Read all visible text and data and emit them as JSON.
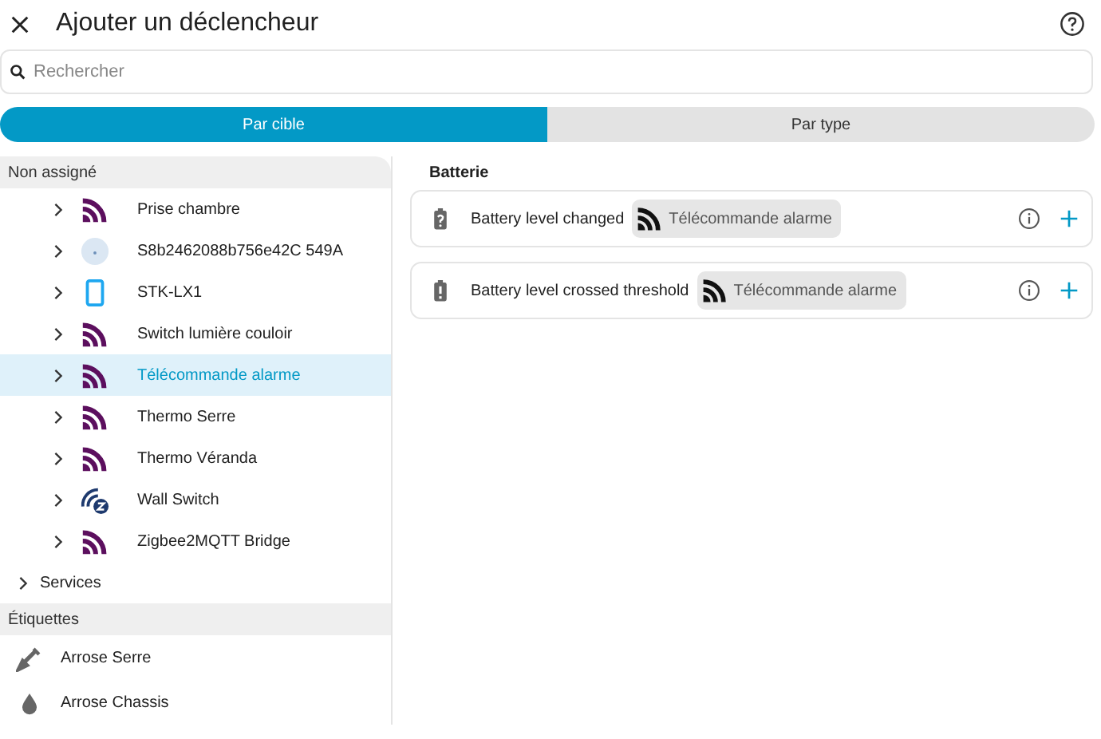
{
  "dialog": {
    "title": "Ajouter un déclencheur"
  },
  "search": {
    "placeholder": "Rechercher"
  },
  "tabs": [
    {
      "label": "Par cible",
      "selected": true
    },
    {
      "label": "Par type",
      "selected": false
    }
  ],
  "sidebar": {
    "sections": [
      {
        "title": "Non assigné",
        "items": [
          {
            "label": "Prise chambre",
            "kind": "signal",
            "selected": false
          },
          {
            "label": "S8b2462088b756e42C 549A",
            "kind": "circle",
            "selected": false
          },
          {
            "label": "STK-LX1",
            "kind": "phone",
            "selected": false
          },
          {
            "label": "Switch lumière couloir",
            "kind": "signal",
            "selected": false
          },
          {
            "label": "Télécommande alarme",
            "kind": "signal",
            "selected": true
          },
          {
            "label": "Thermo Serre",
            "kind": "signal",
            "selected": false
          },
          {
            "label": "Thermo Véranda",
            "kind": "signal",
            "selected": false
          },
          {
            "label": "Wall Switch",
            "kind": "zwave",
            "selected": false
          },
          {
            "label": "Zigbee2MQTT Bridge",
            "kind": "signal",
            "selected": false
          }
        ],
        "groups": [
          {
            "label": "Services"
          }
        ]
      },
      {
        "title": "Étiquettes",
        "items": [
          {
            "label": "Arrose Serre",
            "kind": "shovel",
            "selected": false
          },
          {
            "label": "Arrose Chassis",
            "kind": "drop",
            "selected": false
          }
        ]
      }
    ]
  },
  "content": {
    "heading": "Batterie",
    "triggers": [
      {
        "label": "Battery level changed",
        "kind": "battery-unknown",
        "chip": "Télécommande alarme"
      },
      {
        "label": "Battery level crossed threshold",
        "kind": "battery-alert",
        "chip": "Télécommande alarme"
      }
    ]
  }
}
